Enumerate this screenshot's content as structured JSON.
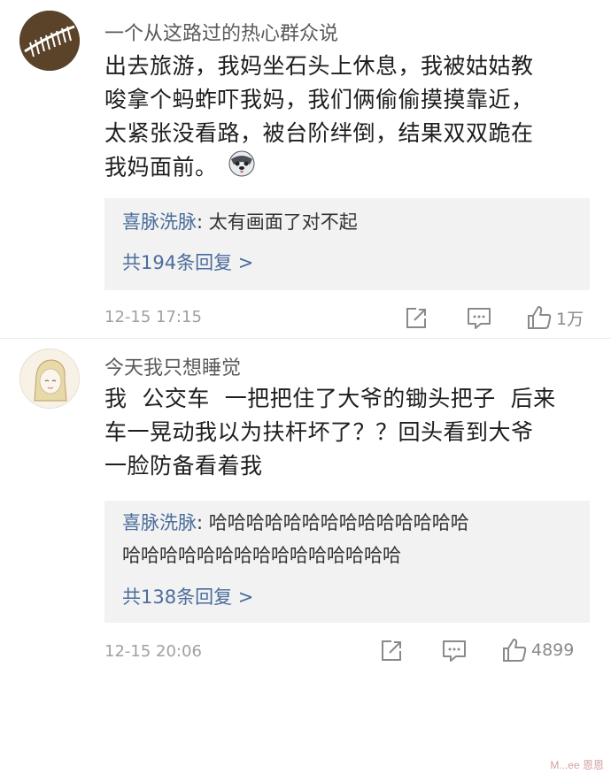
{
  "comments": [
    {
      "username": "一个从这路过的热心群众说",
      "text_lines": [
        "出去旅游，我妈坐石头上休息，我被姑姑教",
        "唆拿个蚂蚱吓我妈，我们俩偷偷摸摸靠近，",
        "太紧张没看路，被台阶绊倒，结果双双跪在",
        "我妈面前。"
      ],
      "emoji_icon": "husky-dog-emoji",
      "reply": {
        "author": "喜脉洗脉",
        "sep": ": ",
        "text_lines": [
          "太有画面了对不起"
        ]
      },
      "more_replies": "共194条回复 >",
      "time": "12-15 17:15",
      "like_count": "1万"
    },
    {
      "username": "今天我只想睡觉",
      "text_lines": [
        "我  公交车  一把把住了大爷的锄头把子  后来",
        "车一晃动我以为扶杆坏了？？回头看到大爷",
        "一脸防备看着我"
      ],
      "reply": {
        "author": "喜脉洗脉",
        "sep": ": ",
        "text_lines": [
          "哈哈哈哈哈哈哈哈哈哈哈哈哈哈",
          "哈哈哈哈哈哈哈哈哈哈哈哈哈哈哈"
        ]
      },
      "more_replies": "共138条回复 >",
      "time": "12-15 20:06",
      "like_count": "4899"
    }
  ],
  "icons": {
    "share": "share-icon",
    "comment": "comment-icon",
    "like": "thumbs-up-icon"
  },
  "colors": {
    "link": "#4a6d9c",
    "reply_bg": "#f2f2f2",
    "meta": "#a0a0a0"
  },
  "watermark": "M...ee 恩恩"
}
